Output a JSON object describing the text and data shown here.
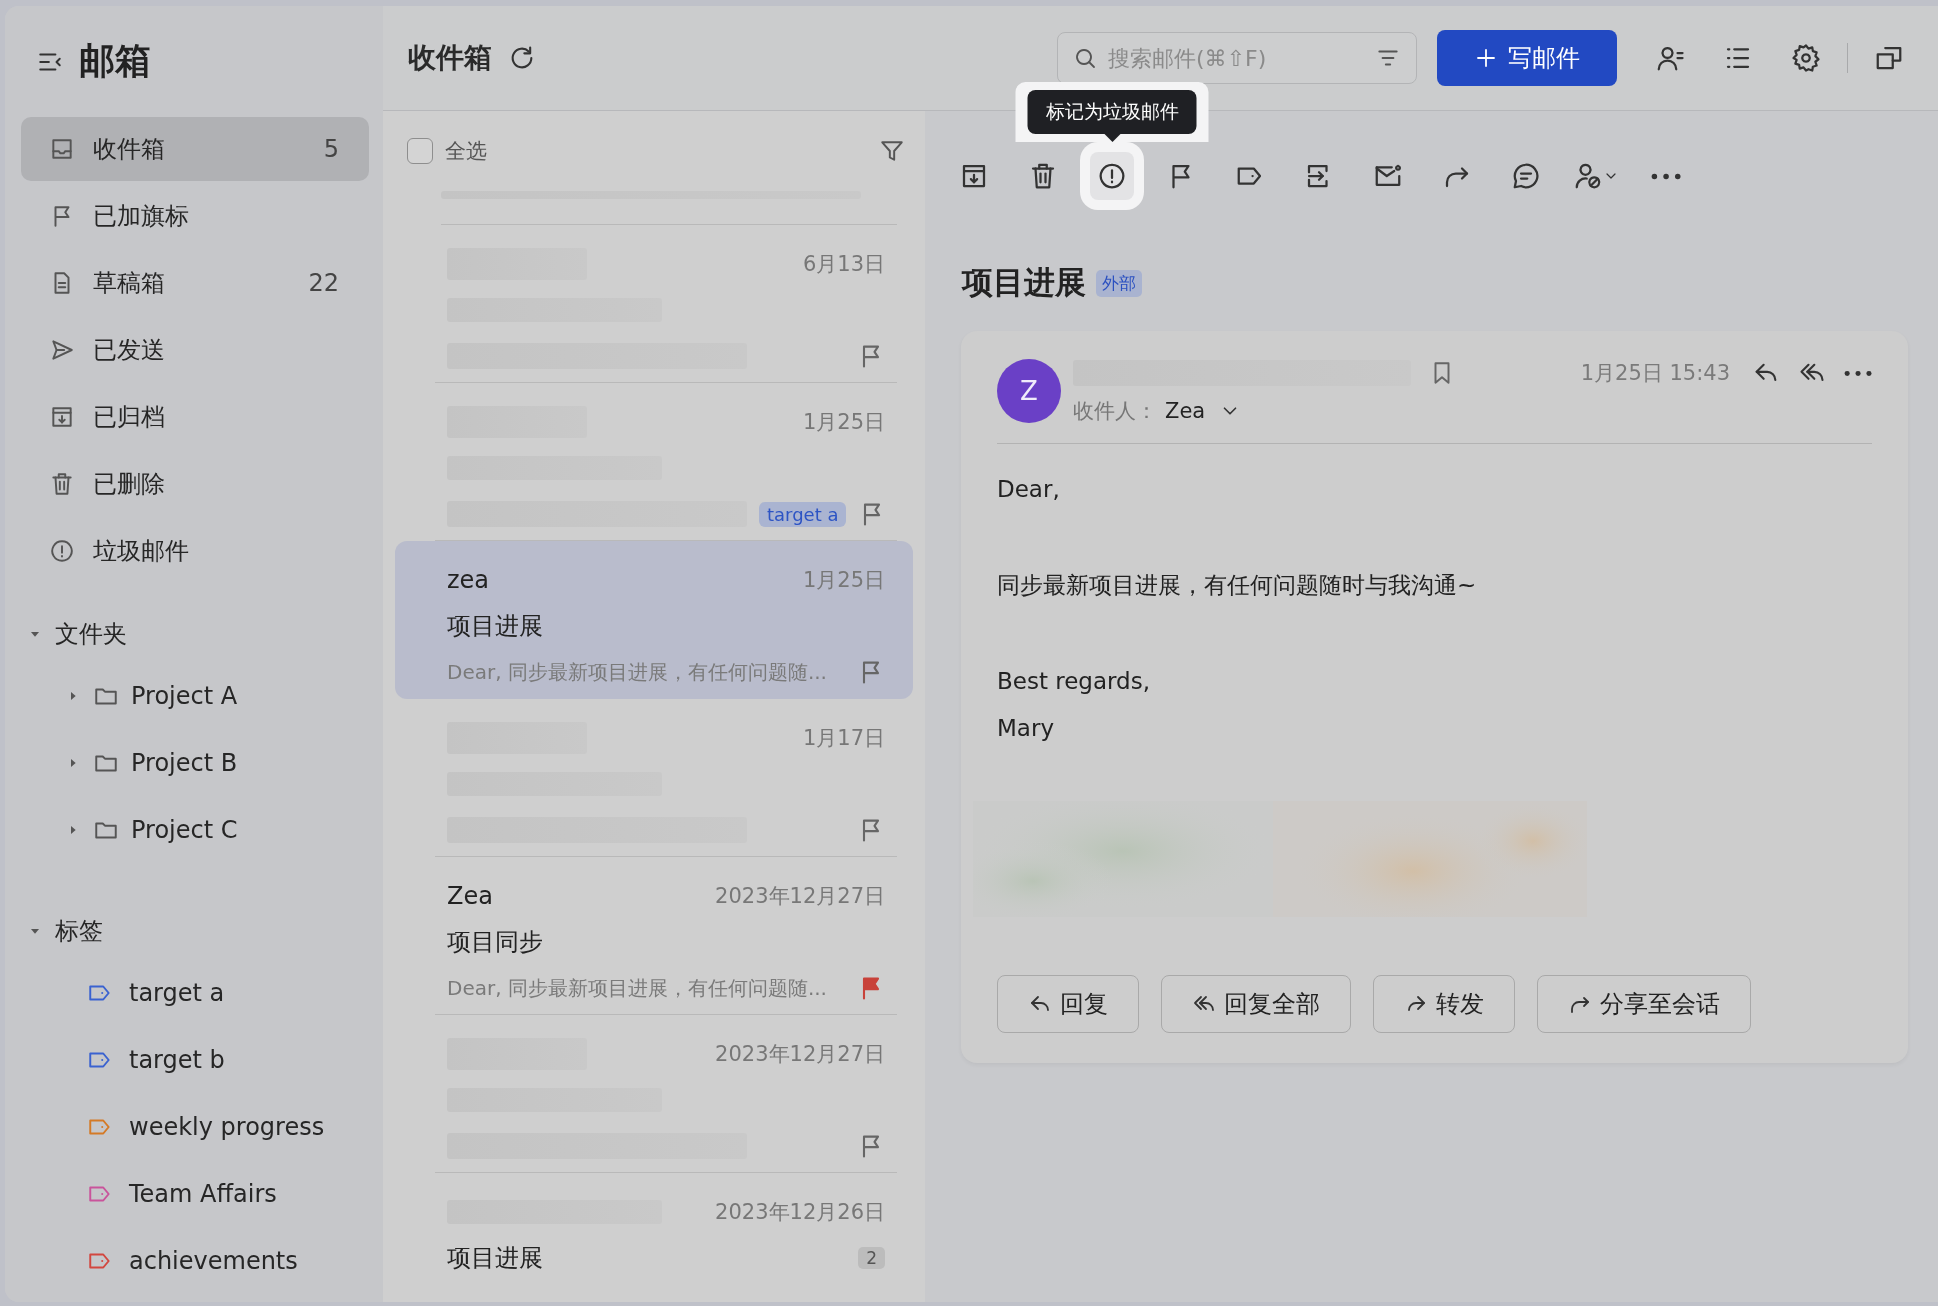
{
  "sidebar": {
    "title": "邮箱",
    "mailboxes": [
      {
        "kind": "inbox",
        "label": "收件箱",
        "count": "5",
        "selected": true
      },
      {
        "kind": "flag",
        "label": "已加旗标",
        "selected": false
      },
      {
        "kind": "draft",
        "label": "草稿箱",
        "count": "22",
        "selected": false
      },
      {
        "kind": "sent",
        "label": "已发送",
        "selected": false
      },
      {
        "kind": "archive",
        "label": "已归档",
        "selected": false
      },
      {
        "kind": "trash",
        "label": "已删除",
        "selected": false
      },
      {
        "kind": "spam",
        "label": "垃圾邮件",
        "selected": false
      }
    ],
    "folders": {
      "title": "文件夹",
      "expanded": true,
      "items": [
        {
          "label": "Project A",
          "expanded": false
        },
        {
          "label": "Project B",
          "expanded": false
        },
        {
          "label": "Project C",
          "expanded": false
        }
      ]
    },
    "tags": {
      "title": "标签",
      "expanded": true,
      "items": [
        {
          "label": "target a",
          "color": "#3a62d0"
        },
        {
          "label": "target b",
          "color": "#3a62d0"
        },
        {
          "label": "weekly progress",
          "color": "#d47a26"
        },
        {
          "label": "Team Affairs",
          "color": "#c9549b"
        },
        {
          "label": "achievements",
          "color": "#d2473f"
        }
      ]
    }
  },
  "header": {
    "title": "收件箱",
    "search": {
      "placeholder": "搜索邮件(⌘⇧F)"
    },
    "compose": "写邮件"
  },
  "mail_list": {
    "select_all": {
      "label": "全选",
      "checked": false
    },
    "items": [
      {
        "kind": "blurred",
        "date": "6月13日",
        "flagged": false,
        "selected": false
      },
      {
        "kind": "blurred",
        "date": "1月25日",
        "tag": "target a",
        "flagged": false,
        "selected": false
      },
      {
        "kind": "message",
        "sender": "zea",
        "subject": "项目进展",
        "preview": "Dear, 同步最新项目进展，有任何问题随...",
        "date": "1月25日",
        "flagged": false,
        "selected": true
      },
      {
        "kind": "blurred",
        "date": "1月17日",
        "flagged": false,
        "selected": false
      },
      {
        "kind": "message",
        "sender": "Zea",
        "subject": "项目同步",
        "preview": "Dear, 同步最新项目进展，有任何问题随...",
        "date": "2023年12月27日",
        "flagged": true,
        "selected": false
      },
      {
        "kind": "blurred",
        "date": "2023年12月27日",
        "flagged": false,
        "selected": false
      },
      {
        "kind": "message",
        "subject": "项目进展",
        "date": "2023年12月26日",
        "count": "2",
        "selected": false
      }
    ]
  },
  "reader": {
    "toolbar": {
      "tooltip": "标记为垃圾邮件",
      "buttons": [
        {
          "kind": "archive",
          "highlighted": false
        },
        {
          "kind": "trash",
          "highlighted": false
        },
        {
          "kind": "spam",
          "highlighted": true
        },
        {
          "kind": "flag",
          "highlighted": false
        },
        {
          "kind": "tag",
          "highlighted": false
        },
        {
          "kind": "move",
          "highlighted": false
        },
        {
          "kind": "mail",
          "highlighted": false
        },
        {
          "kind": "forward",
          "highlighted": false
        },
        {
          "kind": "comment",
          "highlighted": false
        },
        {
          "kind": "contact_block",
          "highlighted": false
        },
        {
          "kind": "more",
          "highlighted": false
        }
      ]
    },
    "subject": "项目进展",
    "badge": "外部",
    "message": {
      "avatar": "Z",
      "date": "1月25日 15:43",
      "recipient_label": "收件人：",
      "recipient": "Zea",
      "body": [
        [
          "Dear,"
        ],
        [
          "同步最新项目进展，有任何问题随时与我沟通~"
        ],
        [
          "Best regards,",
          "Mary"
        ]
      ],
      "attachment": {
        "kind": "picture"
      },
      "actions": [
        {
          "kind": "reply",
          "label": "回复"
        },
        {
          "kind": "reply_all",
          "label": "回复全部"
        },
        {
          "kind": "forward",
          "label": "转发"
        },
        {
          "kind": "share",
          "label": "分享至会话"
        }
      ]
    }
  }
}
